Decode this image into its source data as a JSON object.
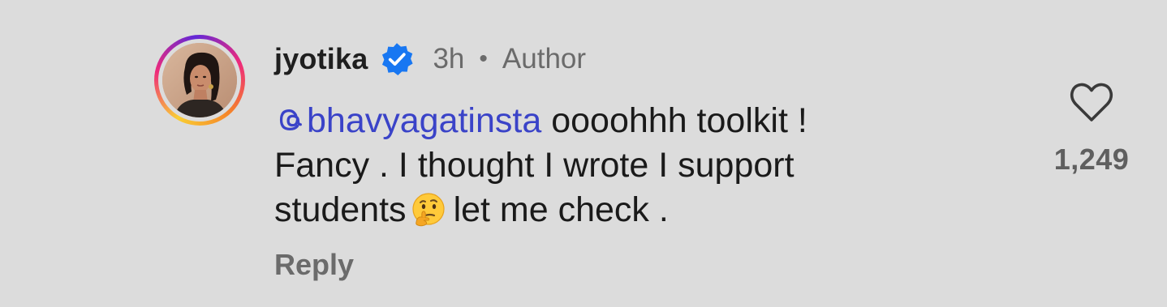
{
  "comment": {
    "username": "jyotika",
    "verified": true,
    "time": "3h",
    "separator": "•",
    "role": "Author",
    "mention": "bhavyagatinsta",
    "text_line1_rest": " oooohhh toolkit !",
    "text_line2": "Fancy .  I thought I wrote I support",
    "text_line3_before_emoji": "students",
    "emoji": "thinking-face",
    "text_line3_after_emoji": "let me check .",
    "reply_label": "Reply",
    "like_count": "1,249"
  },
  "colors": {
    "background": "#dcdcdc",
    "mention": "#3a43c8",
    "verified_badge": "#1877f2",
    "muted_text": "#6b6b6b"
  },
  "icons": {
    "verified": "verified-badge-icon",
    "mention_symbol": "threads-at-icon",
    "like": "heart-outline-icon"
  }
}
